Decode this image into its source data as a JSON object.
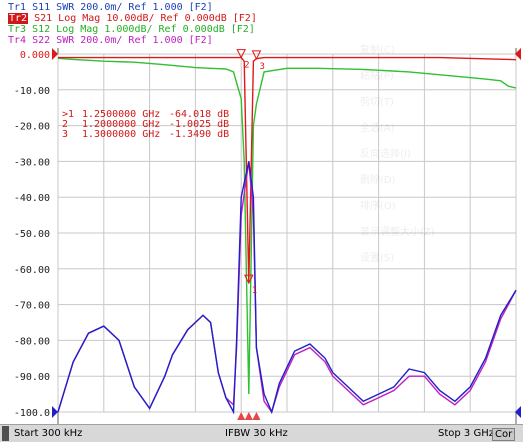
{
  "traces": [
    {
      "id": "Tr1",
      "text": "S11  SWR 200.0m/ Ref 1.000 [F2]",
      "color": "#1a3fb8",
      "selected": false
    },
    {
      "id": "Tr2",
      "text": "S21 Log Mag 10.00dB/ Ref 0.000dB [F2]",
      "color": "#d01818",
      "selected": true
    },
    {
      "id": "Tr3",
      "text": "S12 Log Mag 1.000dB/ Ref 0.000dB [F2]",
      "color": "#22b022",
      "selected": false
    },
    {
      "id": "Tr4",
      "text": "S22  SWR 200.0m/ Ref 1.000 [F2]",
      "color": "#c020c0",
      "selected": false
    }
  ],
  "colors": {
    "grid": "#c8c8c8",
    "s11": "#2020c8",
    "s21": "#e01818",
    "s12": "#30c030",
    "s22": "#c020c0",
    "axis_text": "#d01818"
  },
  "markers": [
    {
      "label": ">1",
      "freq": "1.2500000 GHz",
      "value": "-64.018 dB"
    },
    {
      "label": " 2",
      "freq": "1.2000000 GHz",
      "value": "-1.0025 dB"
    },
    {
      "label": " 3",
      "freq": "1.3000000 GHz",
      "value": "-1.3490 dB"
    }
  ],
  "status": {
    "start": "Start 300 kHz",
    "ifbw": "IFBW 30 kHz",
    "stop": "Stop 3 GHz",
    "cor": "Cor"
  },
  "context_menu": [
    "复制(C)",
    "粘贴(P)",
    "剪切(T)",
    "全选(A)",
    "反向选择(I)",
    "删除(D)",
    "排序(O)",
    "显示调整大小(Z)",
    "设置(S)"
  ],
  "chart_data": {
    "type": "line",
    "ylabel": "",
    "yticks": [
      "0.000",
      "-10.00",
      "-20.00",
      "-30.00",
      "-40.00",
      "-50.00",
      "-60.00",
      "-70.00",
      "-80.00",
      "-90.00",
      "-100.0"
    ],
    "ylim": [
      -100,
      0
    ],
    "xlim_ghz": [
      0.0003,
      3.0
    ],
    "grid": true,
    "series": [
      {
        "name": "S21",
        "key": "s21",
        "x": [
          0.0003,
          0.2,
          0.5,
          0.8,
          1.0,
          1.1,
          1.15,
          1.2,
          1.22,
          1.25,
          1.28,
          1.3,
          1.35,
          1.5,
          2.0,
          2.5,
          2.95,
          3.0
        ],
        "y": [
          -1.0,
          -1.0,
          -1.0,
          -1.0,
          -1.0,
          -1.0,
          -1.0,
          -1.0,
          -2.0,
          -64.018,
          -2.0,
          -1.3,
          -1.0,
          -1.0,
          -1.0,
          -1.0,
          -1.5,
          -1.6
        ]
      },
      {
        "name": "S12",
        "key": "s12",
        "x": [
          0.0003,
          0.1,
          0.3,
          0.5,
          0.7,
          0.9,
          1.0,
          1.1,
          1.15,
          1.2,
          1.22,
          1.25,
          1.28,
          1.3,
          1.35,
          1.5,
          1.7,
          2.0,
          2.3,
          2.6,
          2.8,
          2.9,
          2.95,
          3.0
        ],
        "y": [
          -1.2,
          -1.5,
          -2.0,
          -2.3,
          -3.0,
          -3.8,
          -4.0,
          -4.2,
          -5.0,
          -12.5,
          -30.0,
          -95.0,
          -20.0,
          -14.0,
          -5.0,
          -4.0,
          -4.0,
          -4.3,
          -5.0,
          -6.2,
          -7.0,
          -7.5,
          -9.0,
          -9.5
        ]
      },
      {
        "name": "S11",
        "key": "s11",
        "x": [
          0.0003,
          0.1,
          0.2,
          0.3,
          0.4,
          0.5,
          0.6,
          0.7,
          0.75,
          0.85,
          0.95,
          1.0,
          1.05,
          1.1,
          1.15,
          1.17,
          1.2,
          1.25,
          1.28,
          1.3,
          1.35,
          1.4,
          1.45,
          1.55,
          1.65,
          1.75,
          1.8,
          1.9,
          2.0,
          2.1,
          2.2,
          2.3,
          2.4,
          2.5,
          2.6,
          2.7,
          2.8,
          2.9,
          3.0
        ],
        "y": [
          -100.0,
          -86.0,
          -78.0,
          -76.0,
          -80.0,
          -93.0,
          -99.0,
          -90.0,
          -84.0,
          -77.0,
          -73.0,
          -75.0,
          -89.0,
          -96.0,
          -100.0,
          -80.0,
          -40.0,
          -30.0,
          -40.0,
          -82.0,
          -95.0,
          -100.0,
          -92.0,
          -83.0,
          -81.0,
          -85.0,
          -89.0,
          -93.0,
          -97.0,
          -95.0,
          -93.0,
          -88.0,
          -89.0,
          -94.0,
          -97.0,
          -93.0,
          -85.0,
          -73.0,
          -66.0
        ]
      },
      {
        "name": "S22",
        "key": "s22",
        "x": [
          0.0003,
          0.1,
          0.2,
          0.3,
          0.4,
          0.5,
          0.6,
          0.7,
          0.75,
          0.85,
          0.95,
          1.0,
          1.05,
          1.1,
          1.15,
          1.17,
          1.2,
          1.25,
          1.28,
          1.3,
          1.35,
          1.4,
          1.45,
          1.55,
          1.65,
          1.75,
          1.8,
          1.9,
          2.0,
          2.1,
          2.2,
          2.3,
          2.4,
          2.5,
          2.6,
          2.7,
          2.8,
          2.9,
          3.0
        ],
        "y": [
          -100.0,
          -86.0,
          -78.0,
          -76.0,
          -80.0,
          -93.0,
          -99.0,
          -90.0,
          -84.0,
          -77.0,
          -73.0,
          -75.0,
          -89.0,
          -96.0,
          -98.0,
          -82.0,
          -45.0,
          -30.0,
          -45.0,
          -82.0,
          -97.0,
          -100.0,
          -93.0,
          -84.0,
          -82.0,
          -86.0,
          -90.0,
          -94.0,
          -98.0,
          -96.0,
          -94.0,
          -90.0,
          -90.0,
          -95.0,
          -98.0,
          -94.0,
          -86.0,
          -74.0,
          -66.0
        ]
      }
    ]
  }
}
